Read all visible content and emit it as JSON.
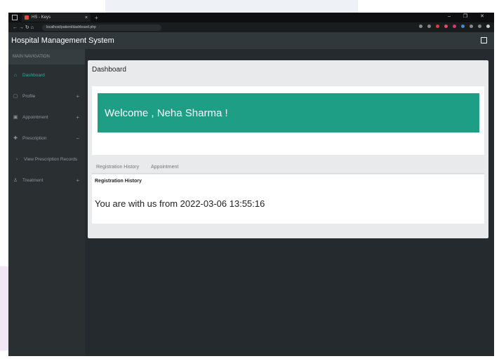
{
  "browser": {
    "tab_title": "HS - Keys",
    "tab_close": "×",
    "new_tab": "+",
    "window_controls": "– ❐ ✕",
    "nav_buttons": "←  →  ↻  ⌂",
    "url": "localhost/patient/dashboard.php"
  },
  "app": {
    "title": "Hospital Management System"
  },
  "sidebar": {
    "header": "MAIN NAVIGATION",
    "items": [
      {
        "icon": "home-icon",
        "glyph": "⌂",
        "label": "Dashboard",
        "arrow": "",
        "active": true
      },
      {
        "icon": "profile-icon",
        "glyph": "▢",
        "label": "Profile",
        "arrow": "+",
        "active": false
      },
      {
        "icon": "appointment-icon",
        "glyph": "▣",
        "label": "Appointment",
        "arrow": "+",
        "active": false
      },
      {
        "icon": "prescription-icon",
        "glyph": "✚",
        "label": "Prescription",
        "arrow": "−",
        "active": false
      },
      {
        "icon": "chevron-right-icon",
        "glyph": "›",
        "label": "View Prescription Records",
        "arrow": "",
        "active": false
      },
      {
        "icon": "treatment-icon",
        "glyph": "♙",
        "label": "Treatment",
        "arrow": "+",
        "active": false
      }
    ]
  },
  "main": {
    "title": "Dashboard",
    "welcome": "Welcome , Neha Sharma !",
    "tabs": [
      "Registration History",
      "Appointment"
    ],
    "section_label": "Registration History",
    "registration_text": "You are with us from 2022-03-06 13:55:16"
  },
  "colors": {
    "accent": "#1f9e86",
    "active_link": "#26b3a1",
    "header_bg": "#31383c",
    "sidebar_bg": "#2a2f31"
  }
}
